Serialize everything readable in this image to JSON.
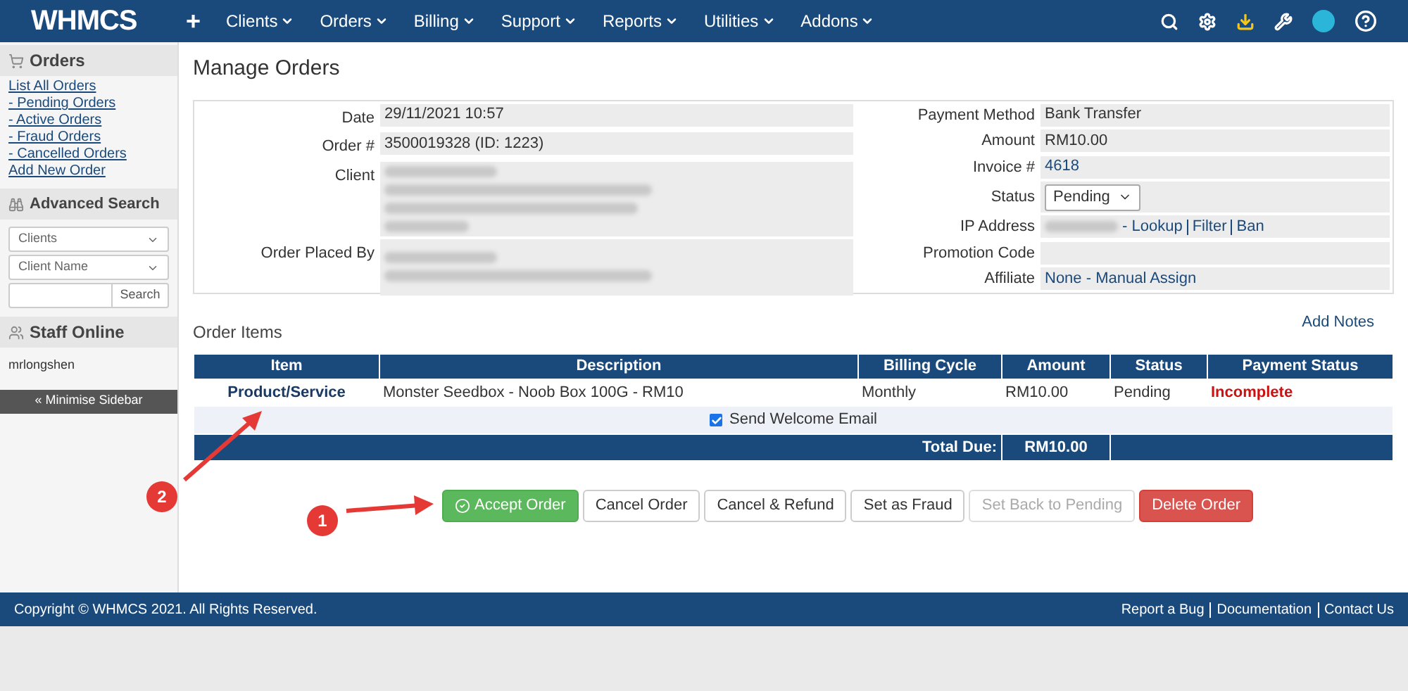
{
  "topbar": {
    "logo": "WHMCS",
    "add": "+",
    "menu": [
      {
        "label": "Clients"
      },
      {
        "label": "Orders"
      },
      {
        "label": "Billing"
      },
      {
        "label": "Support"
      },
      {
        "label": "Reports"
      },
      {
        "label": "Utilities"
      },
      {
        "label": "Addons"
      }
    ]
  },
  "sidebar": {
    "orders_title": "Orders",
    "links": [
      "List All Orders",
      "- Pending Orders",
      "- Active Orders",
      "- Fraud Orders",
      "- Cancelled Orders",
      "Add New Order"
    ],
    "search_title": "Advanced Search",
    "search_selects": [
      "Clients",
      "Client Name"
    ],
    "search_button": "Search",
    "staff_title": "Staff Online",
    "staff": [
      "mrlongshen"
    ],
    "minimise": "« Minimise Sidebar"
  },
  "page_title": "Manage Orders",
  "details_left": [
    {
      "label": "Date",
      "kind": "text",
      "value": "29/11/2021 10:57"
    },
    {
      "label": "Order #",
      "kind": "text",
      "value": "3500019328 (ID: 1223)"
    },
    {
      "label": "Client",
      "kind": "redacted"
    },
    {
      "label": "Order Placed By",
      "kind": "redacted"
    }
  ],
  "details_right": [
    {
      "label": "Payment Method",
      "kind": "text",
      "value": "Bank Transfer"
    },
    {
      "label": "Amount",
      "kind": "text",
      "value": "RM10.00"
    },
    {
      "label": "Invoice #",
      "kind": "link",
      "value": "4618"
    },
    {
      "label": "Status",
      "kind": "select",
      "value": "Pending"
    },
    {
      "label": "IP Address",
      "kind": "ip",
      "links": [
        "- Lookup",
        "Filter",
        "Ban"
      ]
    },
    {
      "label": "Promotion Code",
      "kind": "empty"
    },
    {
      "label": "Affiliate",
      "kind": "link",
      "value": "None - Manual Assign"
    }
  ],
  "order_items": {
    "title": "Order Items",
    "add_notes": "Add Notes",
    "columns": [
      "Item",
      "Description",
      "Billing Cycle",
      "Amount",
      "Status",
      "Payment Status"
    ],
    "rows": [
      {
        "item": "Product/Service",
        "description": "Monster Seedbox - Noob Box 100G - RM10",
        "billing_cycle": "Monthly",
        "amount": "RM10.00",
        "status": "Pending",
        "payment_status": "Incomplete"
      }
    ],
    "welcome_email": {
      "label": "Send Welcome Email",
      "checked": true
    },
    "total_label": "Total Due:",
    "total": "RM10.00"
  },
  "actions": [
    {
      "label": "Accept Order",
      "kind": "success"
    },
    {
      "label": "Cancel Order",
      "kind": "default"
    },
    {
      "label": "Cancel & Refund",
      "kind": "default"
    },
    {
      "label": "Set as Fraud",
      "kind": "default"
    },
    {
      "label": "Set Back to Pending",
      "kind": "disabled"
    },
    {
      "label": "Delete Order",
      "kind": "danger"
    }
  ],
  "annotations": [
    "2",
    "1"
  ],
  "footer": {
    "copyright": "Copyright © WHMCS 2021. All Rights Reserved.",
    "links": [
      "Report a Bug",
      "Documentation",
      "Contact Us"
    ]
  }
}
